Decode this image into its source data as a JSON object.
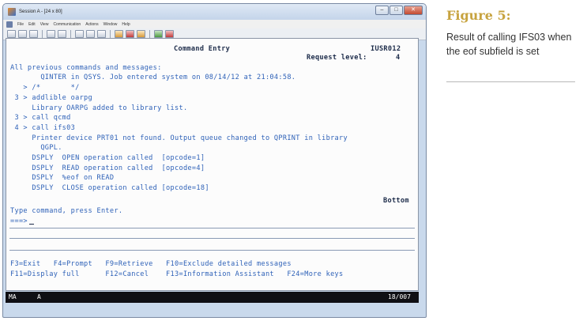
{
  "window": {
    "title": "Session A - [24 x 80]",
    "controls": [
      "–",
      "□",
      "✕"
    ],
    "menu": [
      "File",
      "Edit",
      "View",
      "Communication",
      "Actions",
      "Window",
      "Help"
    ]
  },
  "terminal": {
    "screen_title": "Command Entry",
    "system_name": "IUSR012",
    "request_level_label": "Request level:",
    "request_level": "4",
    "lines": [
      "All previous commands and messages:",
      "       QINTER in QSYS. Job entered system on 08/14/12 at 21:04:58.",
      "   > /*       */",
      " 3 > addlible oarpg",
      "     Library OARPG added to library list.",
      " 3 > call qcmd",
      " 4 > call ifs03",
      "     Printer device PRT01 not found. Output queue changed to QPRINT in library",
      "       QGPL.",
      "     DSPLY  OPEN operation called  [opcode=1]",
      "     DSPLY  READ operation called  [opcode=4]",
      "     DSPLY  %eof on READ",
      "     DSPLY  CLOSE operation called [opcode=18]"
    ],
    "bottom_label": "Bottom",
    "prompt_instruction": "Type command, press Enter.",
    "command_prompt": "===>",
    "function_keys_line1": "F3=Exit   F4=Prompt   F9=Retrieve   F10=Exclude detailed messages",
    "function_keys_line2": "F11=Display full      F12=Cancel    F13=Information Assistant   F24=More keys"
  },
  "status": {
    "indicator": "MA",
    "session": "A",
    "cursor_position": "18/007"
  },
  "figure": {
    "title": "Figure 5:",
    "caption": "Result of calling IFS03 when the eof subfield is set"
  },
  "colors": {
    "terminal_text": "#2f62b8",
    "terminal_emphasis": "#1d2c4a",
    "figure_title": "#c7a33f",
    "status_bar": "#0f0f14"
  }
}
